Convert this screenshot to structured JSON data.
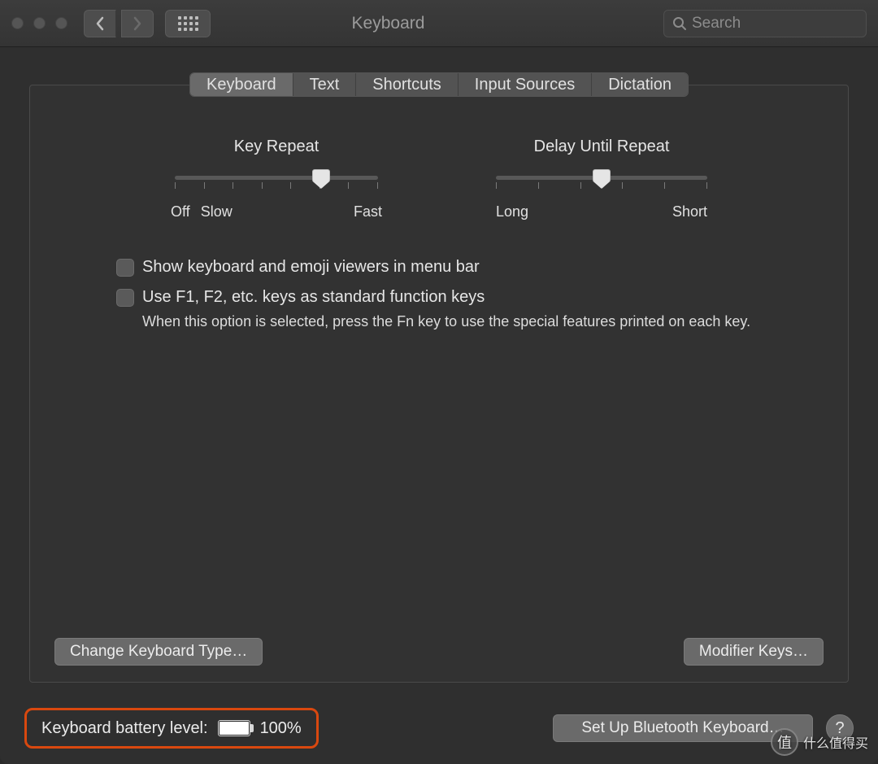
{
  "window": {
    "title": "Keyboard"
  },
  "toolbar": {
    "search_placeholder": "Search"
  },
  "tabs": [
    "Keyboard",
    "Text",
    "Shortcuts",
    "Input Sources",
    "Dictation"
  ],
  "active_tab_index": 0,
  "sliders": {
    "key_repeat": {
      "title": "Key Repeat",
      "left_label": "Off",
      "extra_left": "Slow",
      "right_label": "Fast",
      "ticks": 8,
      "value_pct": 72
    },
    "delay_until_repeat": {
      "title": "Delay Until Repeat",
      "left_label": "Long",
      "right_label": "Short",
      "ticks": 6,
      "value_pct": 50
    }
  },
  "checkboxes": {
    "show_viewers": {
      "label": "Show keyboard and emoji viewers in menu bar",
      "checked": false
    },
    "fn_keys": {
      "label": "Use F1, F2, etc. keys as standard function keys",
      "checked": false,
      "help": "When this option is selected, press the Fn key to use the special features printed on each key."
    }
  },
  "buttons": {
    "change_type": "Change Keyboard Type…",
    "modifier_keys": "Modifier Keys…",
    "setup_bt": "Set Up Bluetooth Keyboard…",
    "help": "?"
  },
  "footer": {
    "battery_label": "Keyboard battery level:",
    "battery_value": "100%",
    "battery_fill_pct": 100
  },
  "watermark": {
    "badge": "值",
    "text": "什么值得买"
  }
}
